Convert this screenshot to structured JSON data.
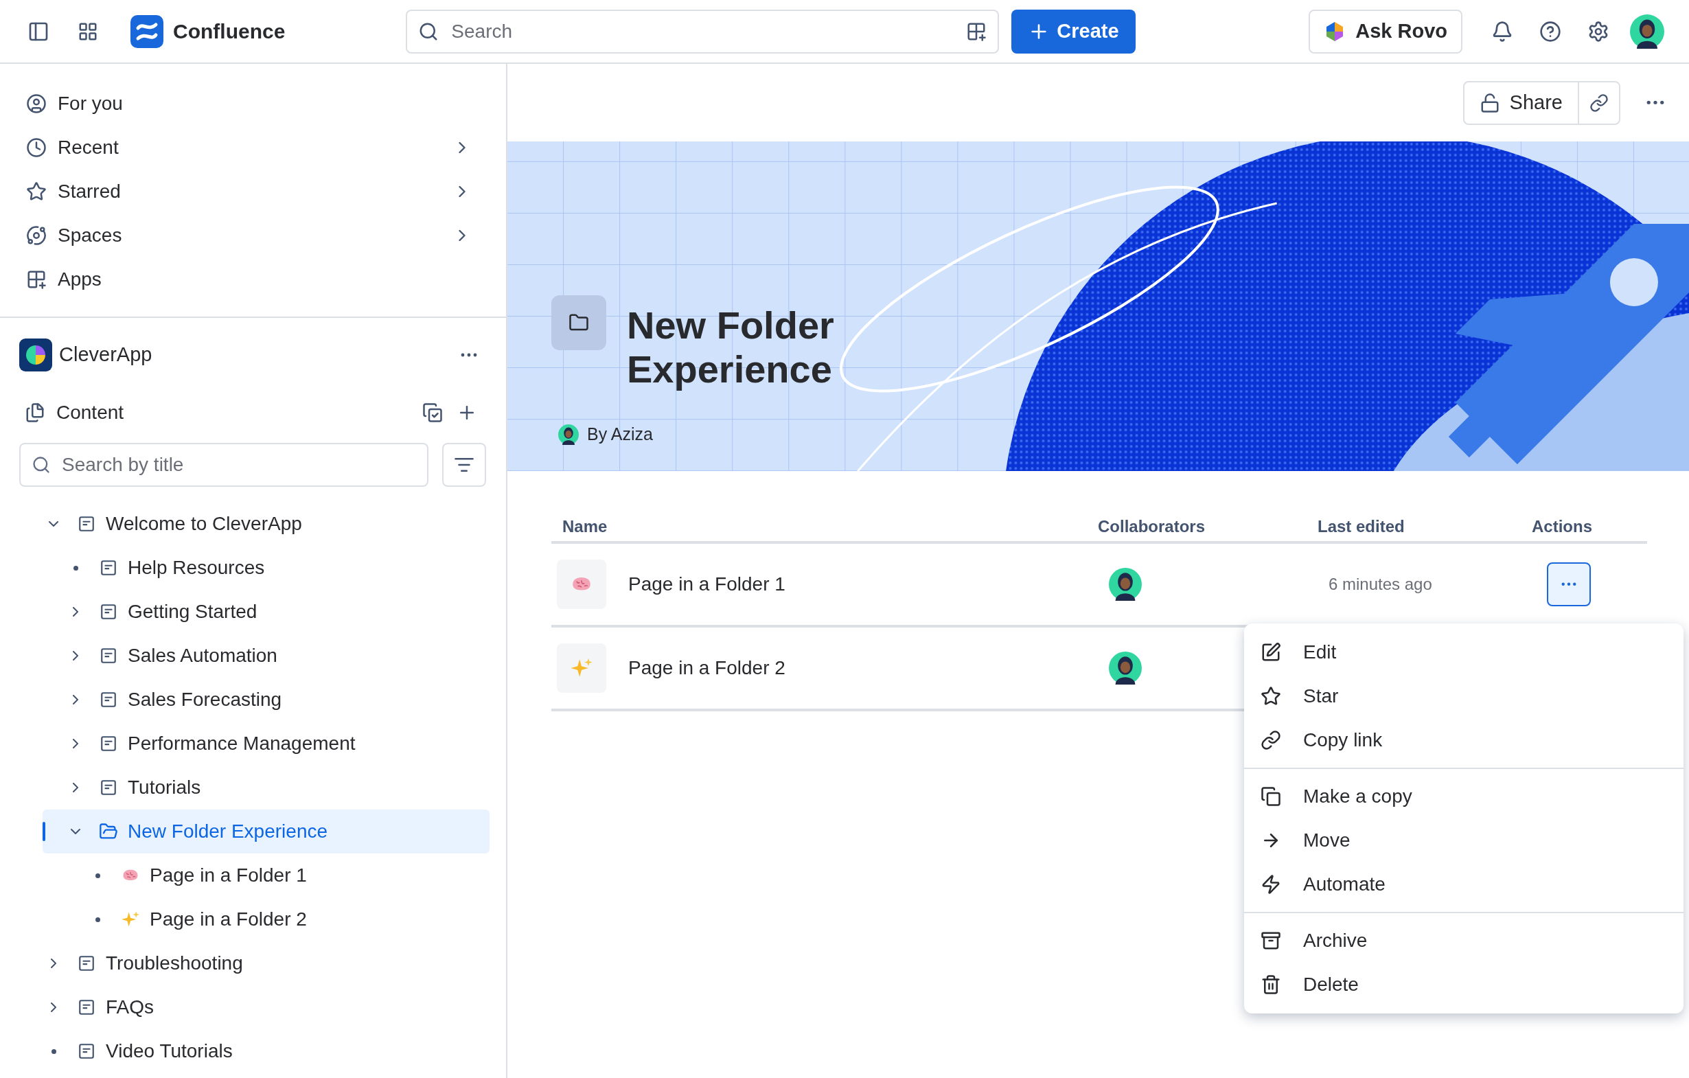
{
  "topbar": {
    "product": "Confluence",
    "search": {
      "placeholder": "Search"
    },
    "create": "Create",
    "ask": "Ask Rovo"
  },
  "nav": [
    {
      "label": "For you",
      "kind": "user",
      "chevron": false
    },
    {
      "label": "Recent",
      "kind": "clock",
      "chevron": true
    },
    {
      "label": "Starred",
      "kind": "star",
      "chevron": true
    },
    {
      "label": "Spaces",
      "kind": "orbit",
      "chevron": true
    },
    {
      "label": "Apps",
      "kind": "apps",
      "chevron": false
    }
  ],
  "space": {
    "name": "CleverApp",
    "section": "Content",
    "filter": {
      "placeholder": "Search by title"
    }
  },
  "tree": [
    {
      "label": "Welcome to CleverApp",
      "kind": "page",
      "expanded": true,
      "selected": false,
      "children": [
        {
          "label": "Help Resources",
          "kind": "page",
          "selected": false
        },
        {
          "label": "Getting Started",
          "kind": "page",
          "expanded": false,
          "selected": false
        },
        {
          "label": "Sales Automation",
          "kind": "page",
          "expanded": false,
          "selected": false
        },
        {
          "label": "Sales Forecasting",
          "kind": "page",
          "expanded": false,
          "selected": false
        },
        {
          "label": "Performance Management",
          "kind": "page",
          "expanded": false,
          "selected": false
        },
        {
          "label": "Tutorials",
          "kind": "page",
          "expanded": false,
          "selected": false
        },
        {
          "label": "New Folder Experience",
          "kind": "folder",
          "expanded": true,
          "selected": true,
          "children": [
            {
              "label": "Page in a Folder 1",
              "kind": "brain",
              "selected": false
            },
            {
              "label": "Page in a Folder 2",
              "kind": "sparkle",
              "selected": false
            }
          ]
        }
      ]
    },
    {
      "label": "Troubleshooting",
      "kind": "page",
      "expanded": false,
      "selected": false
    },
    {
      "label": "FAQs",
      "kind": "page",
      "expanded": false,
      "selected": false
    },
    {
      "label": "Video Tutorials",
      "kind": "page",
      "selected": false
    }
  ],
  "page": {
    "share": "Share",
    "title": "New Folder Experience",
    "byline": "By Aziza"
  },
  "table": {
    "columns": [
      "Name",
      "Collaborators",
      "Last edited",
      "Actions"
    ],
    "rows": [
      {
        "kind": "brain",
        "name": "Page in a Folder 1",
        "last_edited": "6 minutes ago",
        "actions_open": true
      },
      {
        "kind": "sparkle",
        "name": "Page in a Folder 2"
      }
    ]
  },
  "menu": [
    [
      {
        "label": "Edit",
        "kind": "edit"
      },
      {
        "label": "Star",
        "kind": "star"
      },
      {
        "label": "Copy link",
        "kind": "link"
      }
    ],
    [
      {
        "label": "Make a copy",
        "kind": "copy"
      },
      {
        "label": "Move",
        "kind": "move"
      },
      {
        "label": "Automate",
        "kind": "automate"
      }
    ],
    [
      {
        "label": "Archive",
        "kind": "archive"
      },
      {
        "label": "Delete",
        "kind": "delete"
      }
    ]
  ]
}
